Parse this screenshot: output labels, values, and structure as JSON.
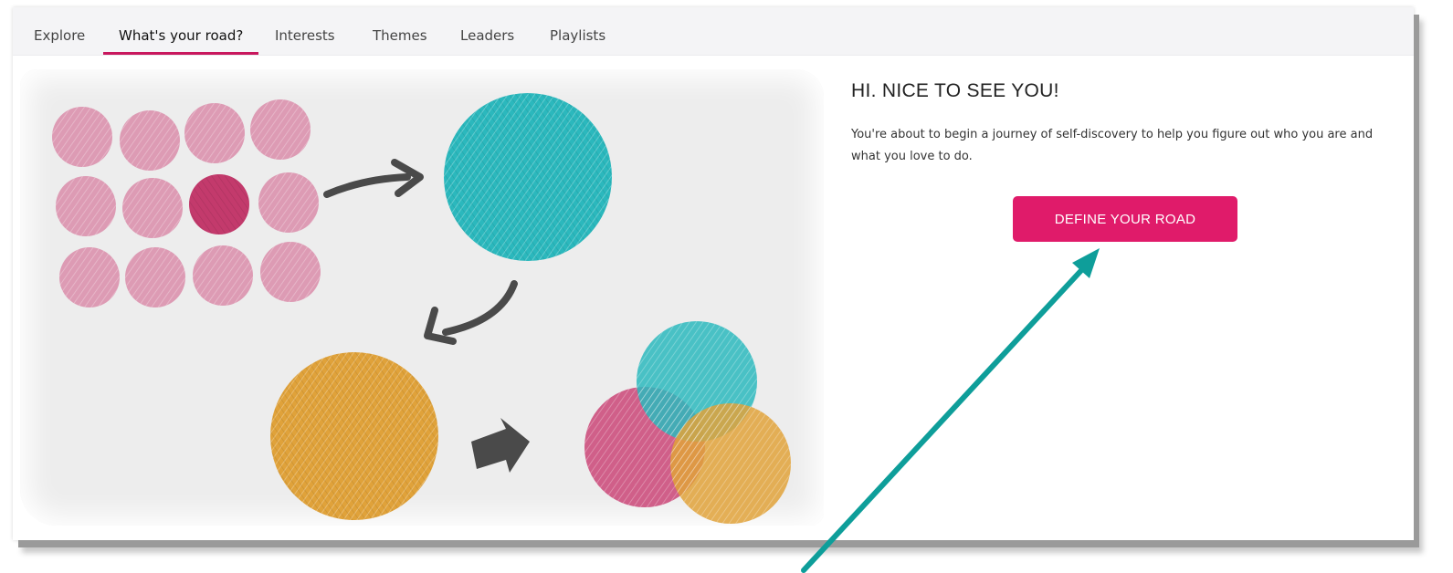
{
  "nav": {
    "tabs": [
      {
        "label": "Explore"
      },
      {
        "label": "What's your road?"
      },
      {
        "label": "Interests"
      },
      {
        "label": "Themes"
      },
      {
        "label": "Leaders"
      },
      {
        "label": "Playlists"
      }
    ],
    "active_tab": "What's your road?"
  },
  "intro": {
    "heading": "HI. NICE TO SEE YOU!",
    "text": "You're about to begin a journey of self-discovery to help you figure out who you are and what you love to do.",
    "button_label": "DEFINE YOUR ROAD"
  },
  "colors": {
    "accent": "#e01b6a",
    "tab_underline": "#c8175d",
    "annotation_arrow": "#0e9e9a",
    "pink_dot": "#dd9bb4",
    "magenta_dot": "#c33a6c",
    "teal_circle": "#2bb8bd",
    "orange_circle": "#e0a23a"
  }
}
